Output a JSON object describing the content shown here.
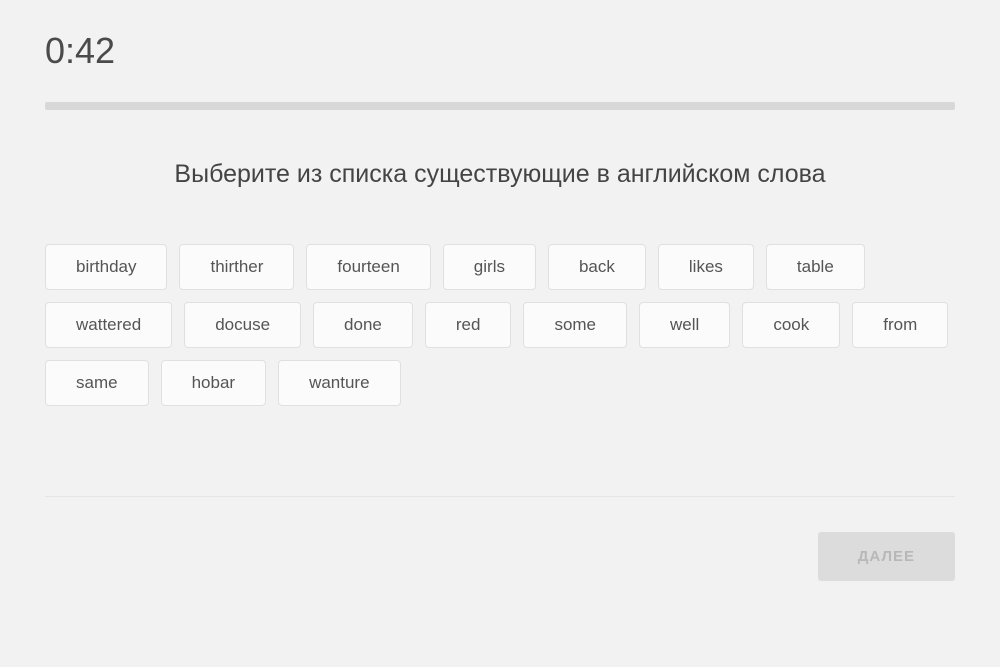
{
  "timer": "0:42",
  "question": "Выберите из списка существующие в английском слова",
  "words": [
    "birthday",
    "thirther",
    "fourteen",
    "girls",
    "back",
    "likes",
    "table",
    "wattered",
    "docuse",
    "done",
    "red",
    "some",
    "well",
    "cook",
    "from",
    "same",
    "hobar",
    "wanture"
  ],
  "next_button": "ДАЛЕЕ"
}
